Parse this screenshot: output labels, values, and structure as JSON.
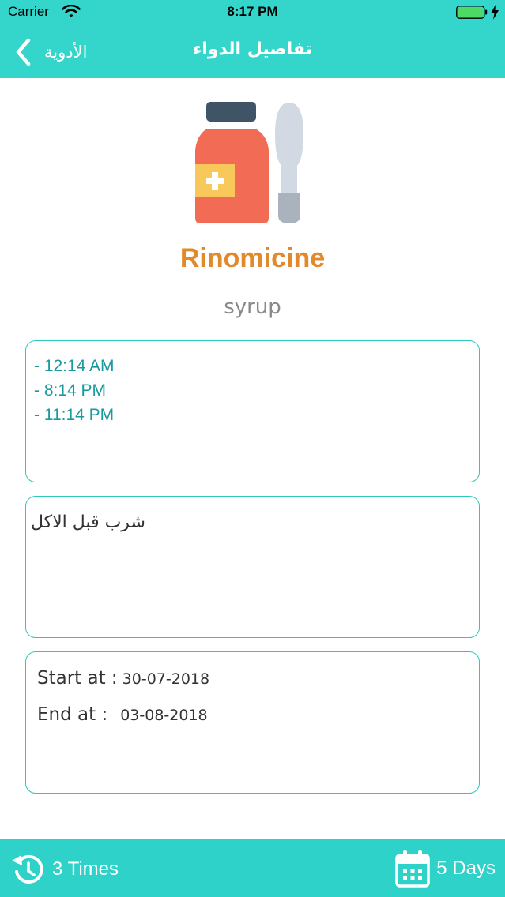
{
  "status_bar": {
    "carrier": "Carrier",
    "time": "8:17 PM",
    "icons": [
      "wifi-icon",
      "battery-icon",
      "charging-bolt-icon"
    ]
  },
  "nav": {
    "back_label": "الأدوية",
    "title": "تفاصيل الدواء",
    "back_icon": "chevron-left-icon"
  },
  "medicine": {
    "illustration_icon": "medicine-bottle-spoon-icon",
    "name": "Rinomicine",
    "type": "syrup"
  },
  "times": [
    "- 12:14 AM",
    "- 8:14 PM",
    "- 11:14 PM"
  ],
  "note": "شرب قبل الاكل",
  "dates": {
    "start_label": "Start at :",
    "start_value": "30-07-2018",
    "end_label": "End at :",
    "end_value": "03-08-2018"
  },
  "footer": {
    "frequency_icon": "history-clock-icon",
    "frequency_label": "3 Times",
    "duration_icon": "calendar-icon",
    "duration_label": "5 Days"
  },
  "colors": {
    "header": "#34d6cc",
    "footer": "#2fd2c8",
    "card_border": "#2cc8bd",
    "medicine_name": "#e2892b",
    "time_text": "#1a9aa0"
  }
}
